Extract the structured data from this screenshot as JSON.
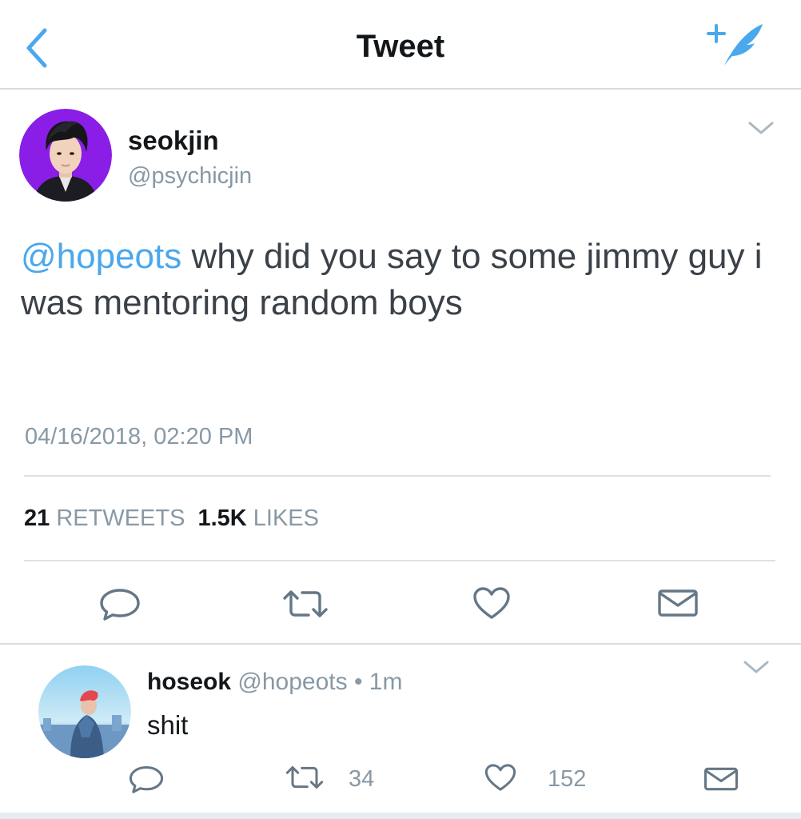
{
  "header": {
    "title": "Tweet",
    "back_icon": "chevron-left-icon",
    "compose_icon": "compose-feather-icon",
    "accent_color": "#4aa8ec"
  },
  "tweet": {
    "display_name": "seokjin",
    "handle": "@psychicjin",
    "mention": "@hopeots",
    "text": " why did you say to some jimmy guy i was mentoring random boys",
    "timestamp": "04/16/2018, 02:20 PM",
    "retweets_count": "21",
    "retweets_label": "RETWEETS",
    "likes_count": "1.5K",
    "likes_label": "LIKES",
    "avatar_background": "#8a1ee6",
    "actions": [
      "reply-icon",
      "retweet-icon",
      "heart-icon",
      "envelope-icon"
    ]
  },
  "reply": {
    "display_name": "hoseok",
    "handle": "@hopeots",
    "separator": "•",
    "time_ago": "1m",
    "text": "shit",
    "retweets_count": "34",
    "likes_count": "152",
    "actions": [
      "reply-icon",
      "retweet-icon",
      "heart-icon",
      "envelope-icon"
    ]
  },
  "colors": {
    "text_primary": "#14171a",
    "text_secondary": "#8899a6",
    "icon_gray": "#657786",
    "divider": "#dde1e4"
  }
}
